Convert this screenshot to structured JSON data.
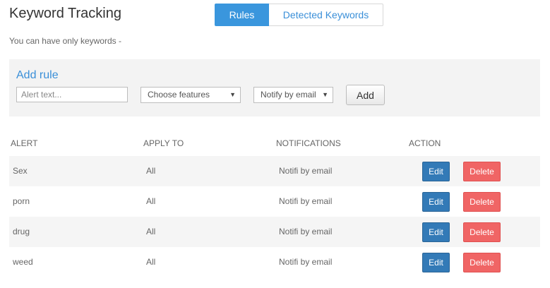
{
  "header": {
    "title": "Keyword Tracking",
    "tabs": [
      {
        "label": "Rules",
        "active": true
      },
      {
        "label": "Detected Keywords",
        "active": false
      }
    ],
    "subtitle": "You can have only keywords -"
  },
  "add_rule": {
    "title": "Add rule",
    "alert_placeholder": "Alert text...",
    "features_select": "Choose features",
    "notify_select": "Notify by email",
    "add_label": "Add"
  },
  "table": {
    "headers": [
      "ALERT",
      "APPLY TO",
      "NOTIFICATIONS",
      "ACTION"
    ],
    "rows": [
      {
        "alert": "Sex",
        "apply_to": "All",
        "notifications": "Notifi by email",
        "edit": "Edit",
        "delete": "Delete"
      },
      {
        "alert": "porn",
        "apply_to": "All",
        "notifications": "Notifi by email",
        "edit": "Edit",
        "delete": "Delete"
      },
      {
        "alert": "drug",
        "apply_to": "All",
        "notifications": "Notifi by email",
        "edit": "Edit",
        "delete": "Delete"
      },
      {
        "alert": "weed",
        "apply_to": "All",
        "notifications": "Notifi by email",
        "edit": "Edit",
        "delete": "Delete"
      }
    ]
  },
  "colors": {
    "accent": "#3a96dd",
    "edit_button": "#337ab7",
    "delete_button": "#f06565",
    "panel_background": "#f3f3f3"
  },
  "icons": {
    "select_arrow": "caret-down-icon"
  }
}
